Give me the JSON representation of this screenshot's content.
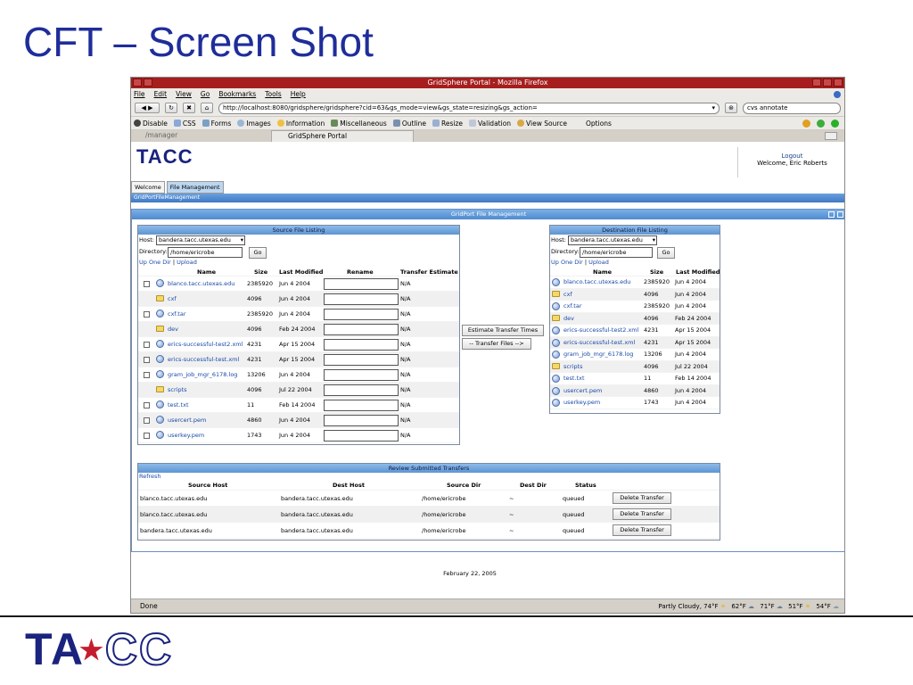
{
  "slide": {
    "title": "CFT – Screen Shot"
  },
  "browser": {
    "window_title": "GridSphere Portal - Mozilla Firefox",
    "menu": [
      "File",
      "Edit",
      "View",
      "Go",
      "Bookmarks",
      "Tools",
      "Help"
    ],
    "url": "http://localhost:8080/gridsphere/gridsphere?cid=63&gs_mode=view&gs_state=resizing&gs_action=",
    "search_value": "cvs annotate",
    "dev_toolbar": [
      "Disable",
      "CSS",
      "Forms",
      "Images",
      "Information",
      "Miscellaneous",
      "Outline",
      "Resize",
      "Validation",
      "View Source",
      "Options"
    ],
    "tabs": [
      "/manager",
      "GridSphere Portal"
    ],
    "status_text": "Done",
    "weather": [
      "Partly Cloudy, 74°F",
      "62°F",
      "71°F",
      "51°F",
      "54°F"
    ]
  },
  "portal": {
    "logo_text": "TACC",
    "logout_label": "Logout",
    "welcome_text": "Welcome, Eric Roberts",
    "page_tabs": [
      "Welcome",
      "File Management"
    ],
    "breadcrumb": "GridPortFileManagement",
    "portlet_title": "GridPort File Management",
    "source": {
      "title": "Source File Listing",
      "host_label": "Host:",
      "host_value": "bandera.tacc.utexas.edu",
      "dir_label": "Directory:",
      "dir_value": "/home/ericrobe",
      "go_label": "Go",
      "up_link": "Up One Dir",
      "sep": "|",
      "upload_link": "Upload",
      "columns": [
        "Name",
        "Size",
        "Last Modified",
        "Rename",
        "Transfer Estimate"
      ],
      "files": [
        {
          "name": "blanco.tacc.utexas.edu",
          "size": "2385920",
          "date": "Jun 4 2004",
          "est": "N/A",
          "kind": "file"
        },
        {
          "name": "cxf",
          "size": "4096",
          "date": "Jun 4 2004",
          "est": "N/A",
          "kind": "dir"
        },
        {
          "name": "cxf.tar",
          "size": "2385920",
          "date": "Jun 4 2004",
          "est": "N/A",
          "kind": "file"
        },
        {
          "name": "dev",
          "size": "4096",
          "date": "Feb 24 2004",
          "est": "N/A",
          "kind": "dir"
        },
        {
          "name": "erics-successful-test2.xml",
          "size": "4231",
          "date": "Apr 15 2004",
          "est": "N/A",
          "kind": "file"
        },
        {
          "name": "erics-successful-test.xml",
          "size": "4231",
          "date": "Apr 15 2004",
          "est": "N/A",
          "kind": "file"
        },
        {
          "name": "gram_job_mgr_6178.log",
          "size": "13206",
          "date": "Jun 4 2004",
          "est": "N/A",
          "kind": "file"
        },
        {
          "name": "scripts",
          "size": "4096",
          "date": "Jul 22 2004",
          "est": "N/A",
          "kind": "dir"
        },
        {
          "name": "test.txt",
          "size": "11",
          "date": "Feb 14 2004",
          "est": "N/A",
          "kind": "file"
        },
        {
          "name": "usercert.pem",
          "size": "4860",
          "date": "Jun 4 2004",
          "est": "N/A",
          "kind": "file"
        },
        {
          "name": "userkey.pem",
          "size": "1743",
          "date": "Jun 4 2004",
          "est": "N/A",
          "kind": "file"
        }
      ]
    },
    "estimate_button": "Estimate Transfer Times",
    "transfer_button": "-- Transfer Files -->",
    "dest": {
      "title": "Destination File Listing",
      "host_label": "Host:",
      "host_value": "bandera.tacc.utexas.edu",
      "dir_label": "Directory:",
      "dir_value": "/home/ericrobe",
      "go_label": "Go",
      "up_link": "Up One Dir",
      "sep": "|",
      "upload_link": "Upload",
      "columns": [
        "Name",
        "Size",
        "Last Modified"
      ],
      "files": [
        {
          "name": "blanco.tacc.utexas.edu",
          "size": "2385920",
          "date": "Jun 4 2004",
          "kind": "file"
        },
        {
          "name": "cxf",
          "size": "4096",
          "date": "Jun 4 2004",
          "kind": "dir"
        },
        {
          "name": "cxf.tar",
          "size": "2385920",
          "date": "Jun 4 2004",
          "kind": "file"
        },
        {
          "name": "dev",
          "size": "4096",
          "date": "Feb 24 2004",
          "kind": "dir"
        },
        {
          "name": "erics-successful-test2.xml",
          "size": "4231",
          "date": "Apr 15 2004",
          "kind": "file"
        },
        {
          "name": "erics-successful-test.xml",
          "size": "4231",
          "date": "Apr 15 2004",
          "kind": "file"
        },
        {
          "name": "gram_job_mgr_6178.log",
          "size": "13206",
          "date": "Jun 4 2004",
          "kind": "file"
        },
        {
          "name": "scripts",
          "size": "4096",
          "date": "Jul 22 2004",
          "kind": "dir"
        },
        {
          "name": "test.txt",
          "size": "11",
          "date": "Feb 14 2004",
          "kind": "file"
        },
        {
          "name": "usercert.pem",
          "size": "4860",
          "date": "Jun 4 2004",
          "kind": "file"
        },
        {
          "name": "userkey.pem",
          "size": "1743",
          "date": "Jun 4 2004",
          "kind": "file"
        }
      ]
    },
    "transfers": {
      "title": "Review Submitted Transfers",
      "refresh_link": "Refresh",
      "columns": [
        "Source Host",
        "Dest Host",
        "Source Dir",
        "Dest Dir",
        "Status"
      ],
      "rows": [
        {
          "src_host": "blanco.tacc.utexas.edu",
          "dest_host": "bandera.tacc.utexas.edu",
          "src_dir": "/home/ericrobe",
          "dest_dir": "~",
          "status": "queued",
          "action": "Delete Transfer"
        },
        {
          "src_host": "blanco.tacc.utexas.edu",
          "dest_host": "bandera.tacc.utexas.edu",
          "src_dir": "/home/ericrobe",
          "dest_dir": "~",
          "status": "queued",
          "action": "Delete Transfer"
        },
        {
          "src_host": "bandera.tacc.utexas.edu",
          "dest_host": "bandera.tacc.utexas.edu",
          "src_dir": "/home/ericrobe",
          "dest_dir": "~",
          "status": "queued",
          "action": "Delete Transfer"
        }
      ]
    },
    "footer_date": "February 22, 2005"
  },
  "footer_logo": {
    "text_blue": "TA",
    "text_c": "CC",
    "star": "★",
    "colors": {
      "navy": "#1a237e",
      "red": "#c41e2e",
      "title_blue": "#1f2d9a"
    }
  }
}
